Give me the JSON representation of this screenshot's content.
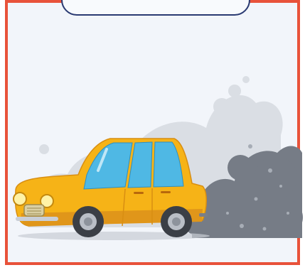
{
  "scene": {
    "subject": "car-exhaust-pollution",
    "colors": {
      "frame_border": "#e8523a",
      "background": "#f2f5fa",
      "tab_outline": "#2a3a72",
      "car_body": "#f6b317",
      "car_shadow": "#e0961a",
      "window_glass": "#4fb8e4",
      "smoke_dark": "#6f757f",
      "smoke_light": "#d9dde3",
      "tire": "#3b3f46"
    }
  }
}
